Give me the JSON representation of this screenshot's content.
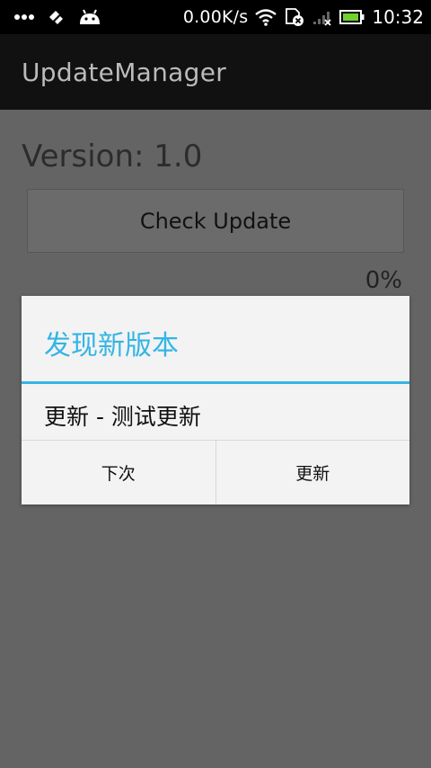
{
  "status_bar": {
    "network_speed": "0.00K/s",
    "time": "10:32",
    "icons": [
      "more-dots-icon",
      "usb-debug-icon",
      "android-icon",
      "wifi-icon",
      "sd-card-error-icon",
      "signal-icon",
      "battery-icon"
    ]
  },
  "action_bar": {
    "title": "UpdateManager"
  },
  "main": {
    "version_label": "Version: 1.0",
    "check_update_label": "Check Update",
    "progress_text": "0%"
  },
  "dialog": {
    "title": "发现新版本",
    "message": "更新 - 测试更新",
    "negative_label": "下次",
    "positive_label": "更新"
  },
  "colors": {
    "accent": "#33b5e5",
    "scrim_background": "#646464",
    "action_bar": "#111111",
    "status_bar": "#000000",
    "dialog_background": "#f3f3f3"
  }
}
